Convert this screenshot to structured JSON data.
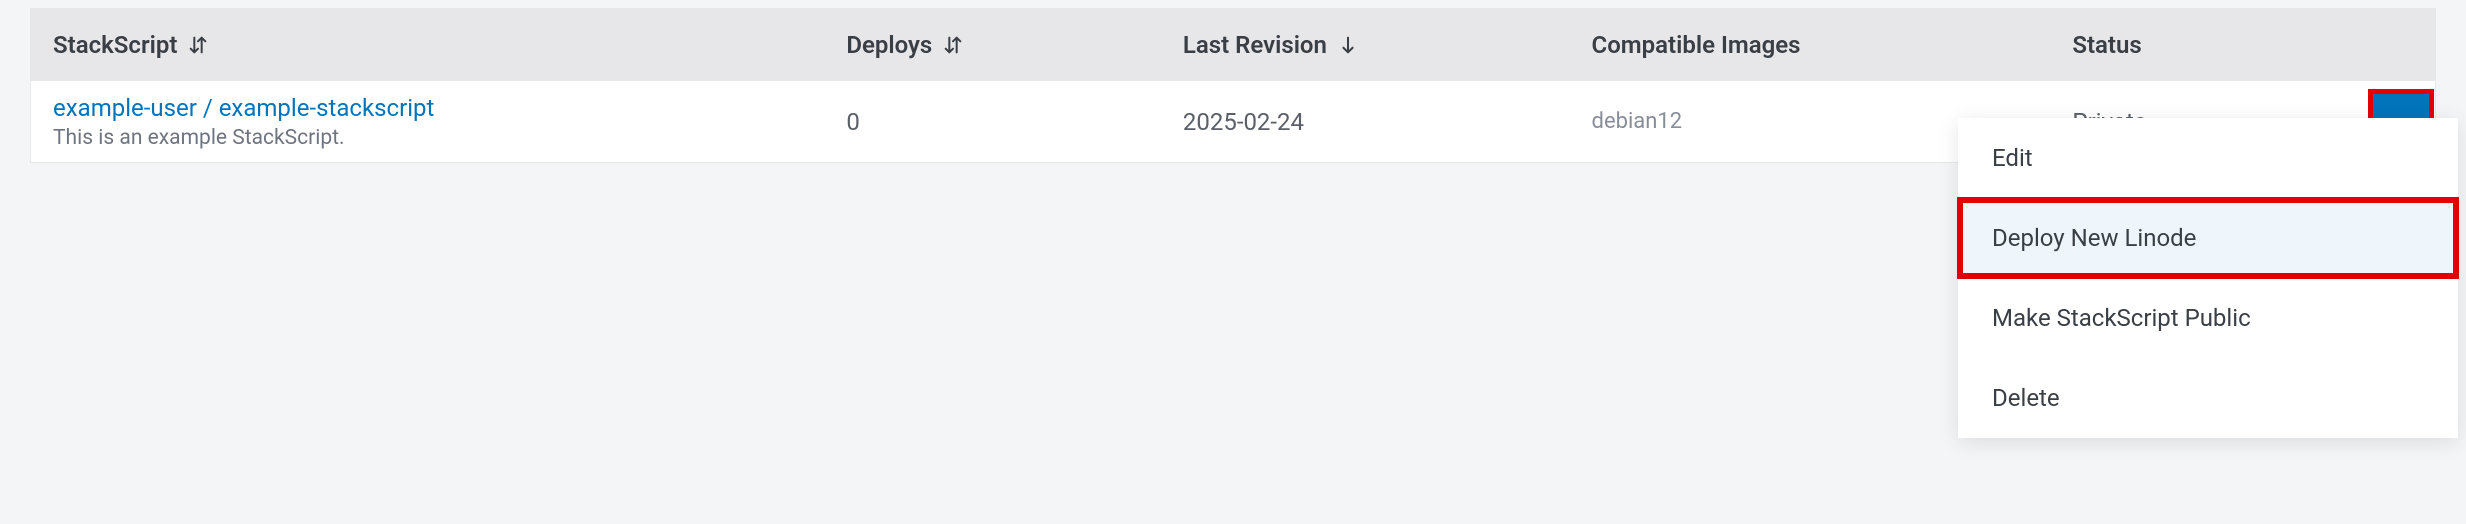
{
  "headers": {
    "stackscript": "StackScript",
    "deploys": "Deploys",
    "last_revision": "Last Revision",
    "compatible_images": "Compatible Images",
    "status": "Status"
  },
  "row": {
    "title": "example-user / example-stackscript",
    "description": "This is an example StackScript.",
    "deploys": "0",
    "last_revision": "2025-02-24",
    "compatible_images": "debian12",
    "status": "Private"
  },
  "menu": {
    "edit": "Edit",
    "deploy": "Deploy New Linode",
    "make_public": "Make StackScript Public",
    "delete": "Delete"
  }
}
